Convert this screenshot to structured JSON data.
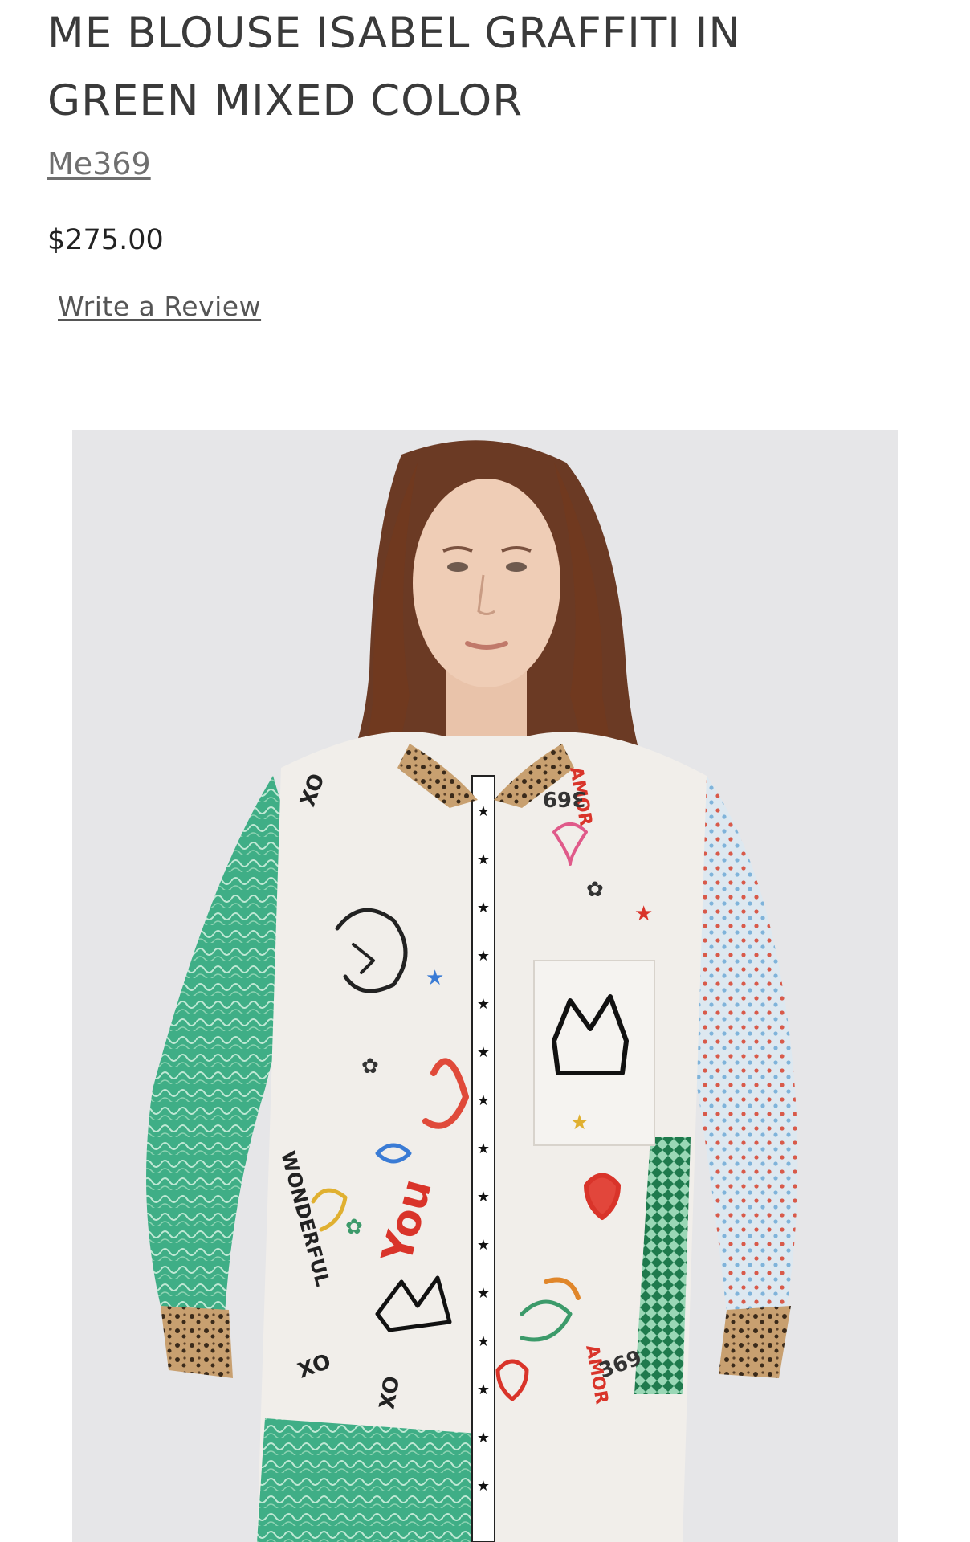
{
  "product": {
    "title_line1": "ME BLOUSE ISABEL GRAFFITI IN",
    "title_line2": "GREEN MIXED COLOR",
    "vendor": "Me369",
    "price": "$275.00",
    "review_link": "Write a Review"
  },
  "image": {
    "alt": "Model wearing graffiti print blouse with green and patterned sleeves and leopard collar"
  },
  "colors": {
    "title": "#3a3a3a",
    "vendor": "#6f6f6f",
    "price": "#222222",
    "image_background": "#e6e6e8",
    "sleeve_green": "#3fae86",
    "sleeve_dots": "#dbe7f0",
    "leopard": "#8a6a45"
  }
}
